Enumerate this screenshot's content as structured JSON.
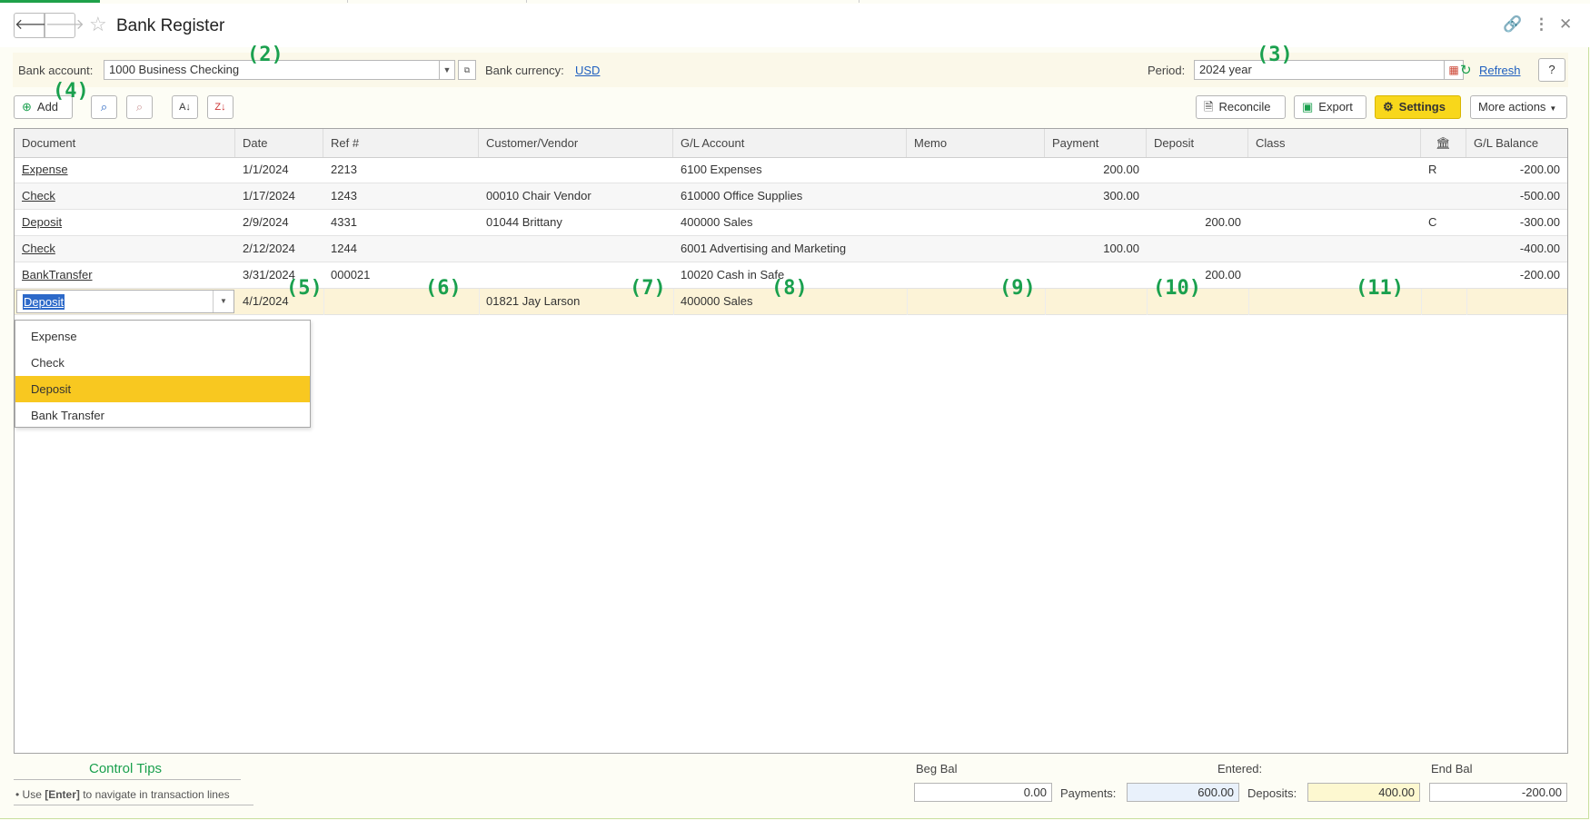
{
  "window": {
    "title": "Bank Register"
  },
  "params": {
    "bank_account_label": "Bank account:",
    "bank_account_value": "1000 Business Checking",
    "bank_currency_label": "Bank currency:",
    "bank_currency_value": "USD",
    "period_label": "Period:",
    "period_value": "2024 year",
    "refresh_label": "Refresh",
    "help_label": "?"
  },
  "toolbar": {
    "add_label": "Add",
    "reconcile_label": "Reconcile",
    "export_label": "Export",
    "settings_label": "Settings",
    "more_actions_label": "More actions"
  },
  "grid": {
    "columns": [
      "Document",
      "Date",
      "Ref #",
      "Customer/Vendor",
      "G/L Account",
      "Memo",
      "Payment",
      "Deposit",
      "Class",
      "",
      "G/L Balance"
    ],
    "rows": [
      {
        "document": "Expense",
        "date": "1/1/2024",
        "ref": "2213",
        "customer": "",
        "account": "6100 Expenses",
        "memo": "",
        "payment": "200.00",
        "deposit": "",
        "class": "",
        "status": "R",
        "balance": "-200.00"
      },
      {
        "document": "Check",
        "date": "1/17/2024",
        "ref": "1243",
        "customer": "00010 Chair Vendor",
        "account": "610000 Office Supplies",
        "memo": "",
        "payment": "300.00",
        "deposit": "",
        "class": "",
        "status": "",
        "balance": "-500.00"
      },
      {
        "document": "Deposit",
        "date": "2/9/2024",
        "ref": "4331",
        "customer": "01044 Brittany",
        "account": "400000 Sales",
        "memo": "",
        "payment": "",
        "deposit": "200.00",
        "class": "",
        "status": "C",
        "balance": "-300.00"
      },
      {
        "document": "Check",
        "date": "2/12/2024",
        "ref": "1244",
        "customer": "",
        "account": "6001 Advertising and Marketing",
        "memo": "",
        "payment": "100.00",
        "deposit": "",
        "class": "",
        "status": "",
        "balance": "-400.00"
      },
      {
        "document": "BankTransfer",
        "date": "3/31/2024",
        "ref": "000021",
        "customer": "",
        "account": "10020 Cash in Safe",
        "memo": "",
        "payment": "",
        "deposit": "200.00",
        "class": "",
        "status": "",
        "balance": "-200.00"
      }
    ],
    "edit_row": {
      "document": "Deposit",
      "date": "4/1/2024",
      "ref": "",
      "customer": "01821 Jay Larson",
      "account": "400000 Sales"
    }
  },
  "dropdown_options": [
    "Expense",
    "Check",
    "Deposit",
    "Bank Transfer"
  ],
  "dropdown_selected": "Deposit",
  "markers": [
    "(2)",
    "(3)",
    "(4)",
    "(5)",
    "(6)",
    "(7)",
    "(8)",
    "(9)",
    "(10)",
    "(11)"
  ],
  "footer": {
    "tips_title": "Control Tips",
    "tip_prefix": "• Use ",
    "tip_key": "[Enter]",
    "tip_suffix": " to navigate in transaction lines",
    "beg_bal_label": "Beg Bal",
    "beg_bal_value": "0.00",
    "entered_label": "Entered:",
    "payments_label": "Payments:",
    "payments_value": "600.00",
    "deposits_label": "Deposits:",
    "deposits_value": "400.00",
    "end_bal_label": "End Bal",
    "end_bal_value": "-200.00"
  },
  "colors": {
    "accent_green": "#1aa04e",
    "settings_yellow": "#f8d71b",
    "selection_yellow": "#f8c820",
    "link_blue": "#1f5fbf"
  }
}
